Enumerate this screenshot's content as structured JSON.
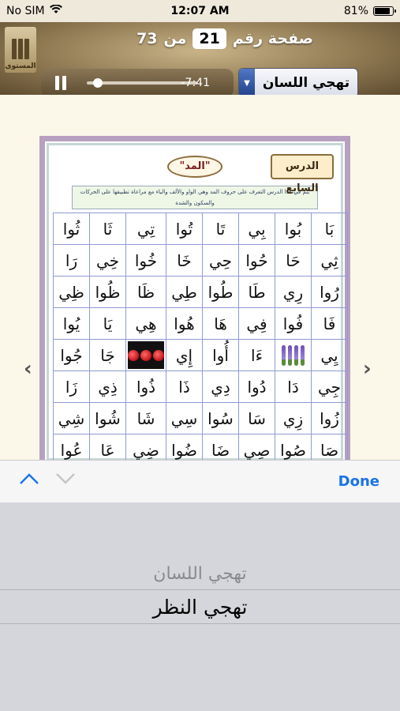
{
  "status_bar": {
    "carrier": "No SIM",
    "time": "12:07 AM",
    "battery": "81%",
    "battery_level": 0.81
  },
  "header": {
    "logo_text": "المستوى",
    "page_label": "صفحة رقم",
    "page_number": "21",
    "page_of": "من",
    "page_total": "73"
  },
  "player": {
    "remaining": "-7:41",
    "progress": 0.1
  },
  "reciter_select": {
    "value": "تهجي اللسان"
  },
  "lesson": {
    "lesson_title": "الدرس السابع",
    "topic": "\"المد\"",
    "description": "يتم في هذا الدرس التعرف على حروف المد وهي الواو والألف والياء مع مراعاة تطبيقها على الحركات والسكون والشدة"
  },
  "grid_cells": [
    "بَا",
    "بُوا",
    "بِي",
    "تَا",
    "تُوا",
    "تِي",
    "ثَا",
    "ثُوا",
    "ثِي",
    "حَا",
    "حُوا",
    "حِي",
    "خَا",
    "خُوا",
    "خِي",
    "رَا",
    "رُوا",
    "رِي",
    "طَا",
    "طُوا",
    "طِي",
    "ظَا",
    "ظُوا",
    "ظِي",
    "فَا",
    "فُوا",
    "فِي",
    "هَا",
    "هُوا",
    "هِي",
    "يَا",
    "يُوا",
    "يِي",
    "",
    "ءَا",
    "أُوا",
    "إِي",
    "",
    "جَا",
    "جُوا",
    "جِي",
    "دَا",
    "دُوا",
    "دِي",
    "ذَا",
    "ذُوا",
    "ذِي",
    "زَا",
    "زُوا",
    "زِي",
    "سَا",
    "سُوا",
    "سِي",
    "شَا",
    "شُوا",
    "شِي",
    "صَا",
    "صُوا",
    "صِي",
    "ضَا",
    "ضُوا",
    "ضِي",
    "عَا",
    "عُوا"
  ],
  "accessory": {
    "done_label": "Done"
  },
  "picker": {
    "options": [
      "تهجي اللسان",
      "تهجي النظر"
    ],
    "selected": "تهجي النظر"
  },
  "colors": {
    "accent": "#1a73e8",
    "header_brown": "#8c7650",
    "grid_line": "#8e9bd2"
  }
}
